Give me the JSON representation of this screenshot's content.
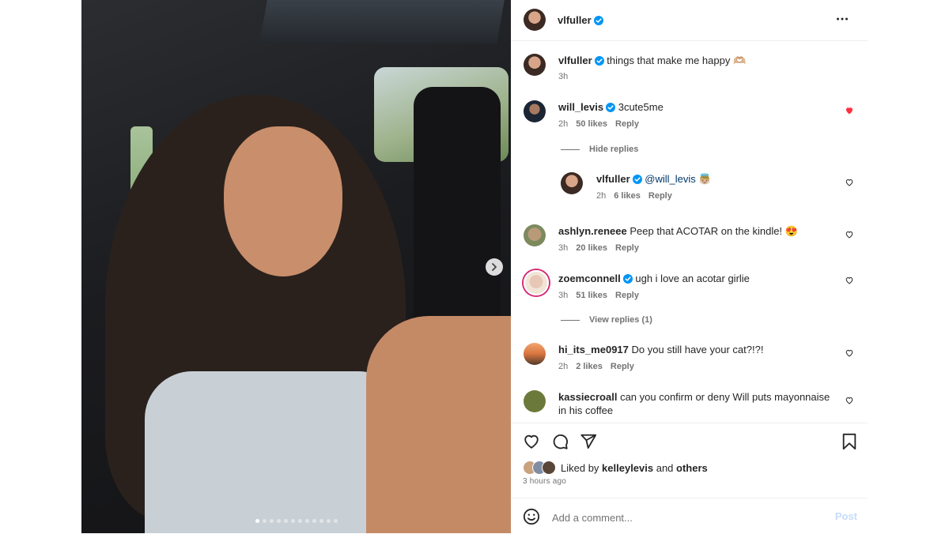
{
  "post": {
    "owner": "vlfuller",
    "carousel_dot_count": 12,
    "carousel_active_index": 0
  },
  "caption": {
    "username": "vlfuller",
    "text": "things that make me happy 🫶🏼",
    "time": "3h"
  },
  "comments": [
    {
      "username": "will_levis",
      "text": "3cute5me",
      "time": "2h",
      "likes": "50 likes",
      "reply": "Reply",
      "liked": true
    },
    {
      "username": "vlfuller",
      "text": "@will_levis 👼🏼",
      "time": "2h",
      "likes": "6 likes",
      "reply": "Reply"
    },
    {
      "username": "ashlyn.reneee",
      "text": "Peep that ACOTAR on the kindle! 😍",
      "time": "3h",
      "likes": "20 likes",
      "reply": "Reply"
    },
    {
      "username": "zoemconnell",
      "text": "ugh i love an acotar girlie",
      "time": "3h",
      "likes": "51 likes",
      "reply": "Reply"
    },
    {
      "username": "hi_its_me0917",
      "text": "Do you still have your cat?!?!",
      "time": "2h",
      "likes": "2 likes",
      "reply": "Reply"
    },
    {
      "username": "kassiecroall",
      "text": "can you confirm or deny Will puts mayonnaise in his coffee"
    }
  ],
  "hide_replies": "Hide replies",
  "view_replies": "View replies (1)",
  "liked_by": {
    "prefix": "Liked by ",
    "name": "kelleylevis",
    "middle": " and ",
    "others": "others"
  },
  "post_time": "3 hours ago",
  "add_comment": {
    "placeholder": "Add a comment...",
    "post_label": "Post"
  },
  "icons": {
    "verified": "verified-badge-icon",
    "more": "more-horizontal-icon",
    "next": "chevron-right-icon",
    "like": "heart-icon",
    "comment": "comment-bubble-icon",
    "share": "paper-plane-icon",
    "save": "bookmark-icon",
    "emoji": "smiley-icon"
  },
  "colors": {
    "verified": "#0095f6",
    "liked_heart": "#ff3040",
    "post_disabled": "#c5dcfa"
  }
}
